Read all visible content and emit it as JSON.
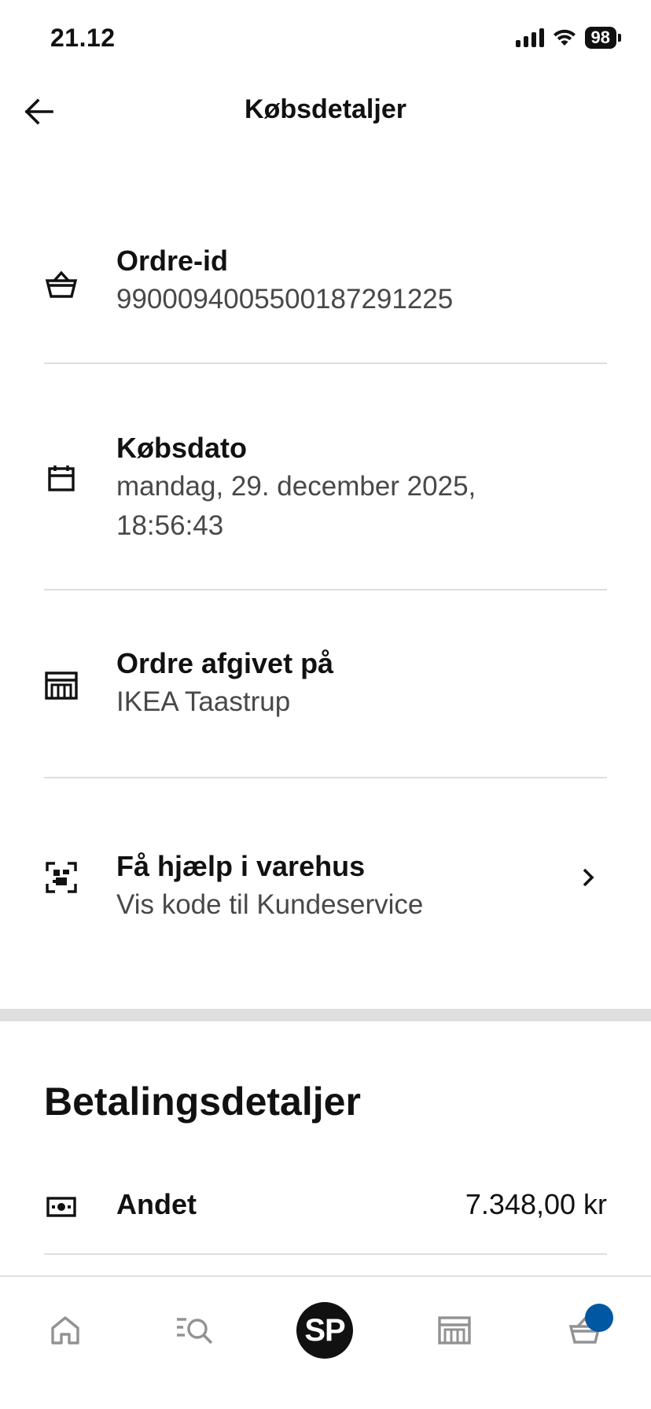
{
  "status_bar": {
    "time": "21.12",
    "battery": "98",
    "icons": [
      "signal-icon",
      "wifi-icon",
      "battery-icon"
    ]
  },
  "header": {
    "title": "Købsdetaljer",
    "back_icon": "arrow-left-icon"
  },
  "details": [
    {
      "icon": "basket-icon",
      "label": "Ordre-id",
      "value": "9900094005500187291225"
    },
    {
      "icon": "calendar-icon",
      "label": "Købsdato",
      "value_line1": "mandag, 29. december 2025,",
      "value_line2": "18:56:43"
    },
    {
      "icon": "store-icon",
      "label": "Ordre afgivet på",
      "value": "IKEA Taastrup"
    },
    {
      "icon": "qr-code-icon",
      "label": "Få hjælp i varehus",
      "value": "Vis kode til Kundeservice",
      "chevron_icon": "chevron-right-icon"
    }
  ],
  "payment": {
    "title": "Betalingsdetaljer",
    "rows": [
      {
        "icon": "cash-icon",
        "label": "Andet",
        "amount": "7.348,00 kr"
      }
    ]
  },
  "bottom_nav": {
    "items": [
      {
        "name": "home",
        "icon": "home-icon"
      },
      {
        "name": "search",
        "icon": "search-list-icon"
      },
      {
        "name": "profile",
        "icon": "avatar",
        "initials": "SP"
      },
      {
        "name": "store",
        "icon": "store-icon"
      },
      {
        "name": "basket",
        "icon": "basket-icon",
        "badge": true
      }
    ],
    "colors": {
      "badge": "#0058a3",
      "inactive_icon": "#929292"
    }
  },
  "colors": {
    "text_primary": "#111111",
    "text_secondary": "#484848",
    "divider": "#dfdfdf",
    "background": "#ffffff"
  }
}
